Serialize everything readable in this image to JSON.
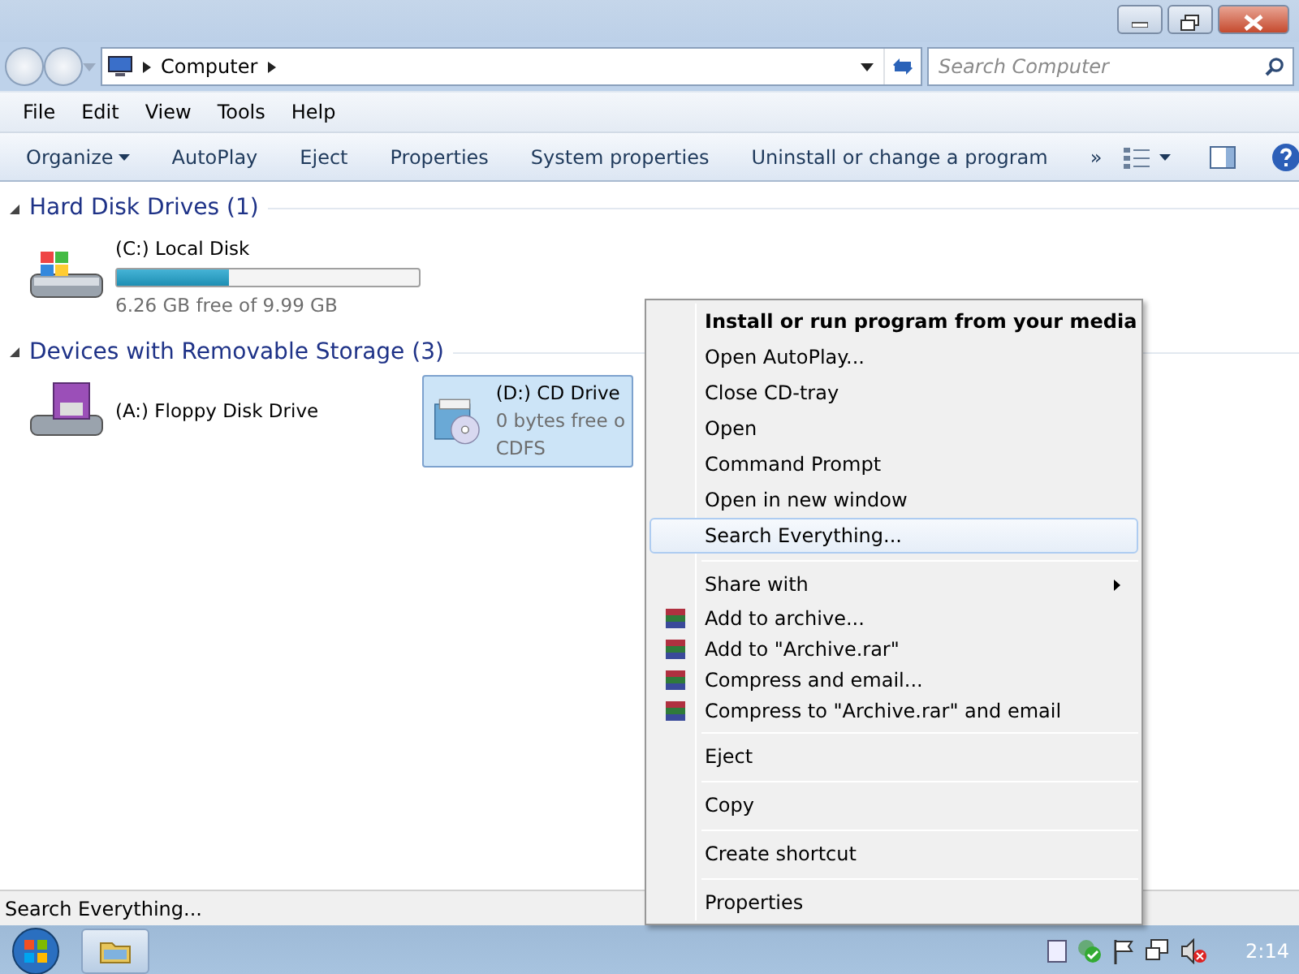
{
  "address_bar": {
    "path": [
      "Computer"
    ]
  },
  "search": {
    "placeholder": "Search Computer"
  },
  "menu_bar": [
    "File",
    "Edit",
    "View",
    "Tools",
    "Help"
  ],
  "toolbar": {
    "items": [
      {
        "label": "Organize",
        "dropdown": true
      },
      {
        "label": "AutoPlay",
        "dropdown": false
      },
      {
        "label": "Eject",
        "dropdown": false
      },
      {
        "label": "Properties",
        "dropdown": false
      },
      {
        "label": "System properties",
        "dropdown": false
      },
      {
        "label": "Uninstall or change a program",
        "dropdown": false
      }
    ],
    "more": "»"
  },
  "groups": [
    {
      "title": "Hard Disk Drives (1)",
      "expanded": true,
      "items": [
        {
          "kind": "harddisk",
          "name": "(C:) Local Disk",
          "level": 0.37,
          "details": [
            "6.26 GB free of 9.99 GB"
          ],
          "selected": false
        }
      ]
    },
    {
      "title": "Devices with Removable Storage (3)",
      "expanded": true,
      "items": [
        {
          "kind": "floppy",
          "name": "(A:) Floppy Disk Drive",
          "selected": false
        },
        {
          "kind": "cd",
          "name": "(D:) CD Drive",
          "details": [
            "0 bytes free o",
            "CDFS"
          ],
          "selected": true
        }
      ]
    }
  ],
  "context_menu": [
    {
      "kind": "item",
      "label": "Install or run program from your media",
      "bold": true,
      "selected": false
    },
    {
      "kind": "item",
      "label": "Open AutoPlay...",
      "bold": false,
      "selected": false
    },
    {
      "kind": "item",
      "label": "Close CD-tray",
      "bold": false,
      "selected": false
    },
    {
      "kind": "item",
      "label": "Open",
      "bold": false,
      "selected": false
    },
    {
      "kind": "item",
      "label": "Command Prompt",
      "bold": false,
      "selected": false
    },
    {
      "kind": "item",
      "label": "Open in new window",
      "bold": false,
      "selected": false
    },
    {
      "kind": "item",
      "label": "Search Everything...",
      "bold": false,
      "selected": true
    },
    {
      "kind": "separator"
    },
    {
      "kind": "submenu",
      "label": "Share with",
      "bold": false,
      "selected": false
    },
    {
      "kind": "archive",
      "label": "Add to archive...",
      "bold": false,
      "selected": false
    },
    {
      "kind": "archive",
      "label": "Add to \"Archive.rar\"",
      "bold": false,
      "selected": false
    },
    {
      "kind": "archive",
      "label": "Compress and email...",
      "bold": false,
      "selected": false
    },
    {
      "kind": "archive",
      "label": "Compress to \"Archive.rar\" and email",
      "bold": false,
      "selected": false
    },
    {
      "kind": "separator"
    },
    {
      "kind": "item",
      "label": "Eject",
      "bold": false,
      "selected": false
    },
    {
      "kind": "separator"
    },
    {
      "kind": "item",
      "label": "Copy",
      "bold": false,
      "selected": false
    },
    {
      "kind": "separator"
    },
    {
      "kind": "item",
      "label": "Create shortcut",
      "bold": false,
      "selected": false
    },
    {
      "kind": "separator"
    },
    {
      "kind": "item",
      "label": "Properties",
      "bold": false,
      "selected": false
    }
  ],
  "status_bar": "Search Everything...",
  "taskbar": {
    "clock": "2:14"
  }
}
